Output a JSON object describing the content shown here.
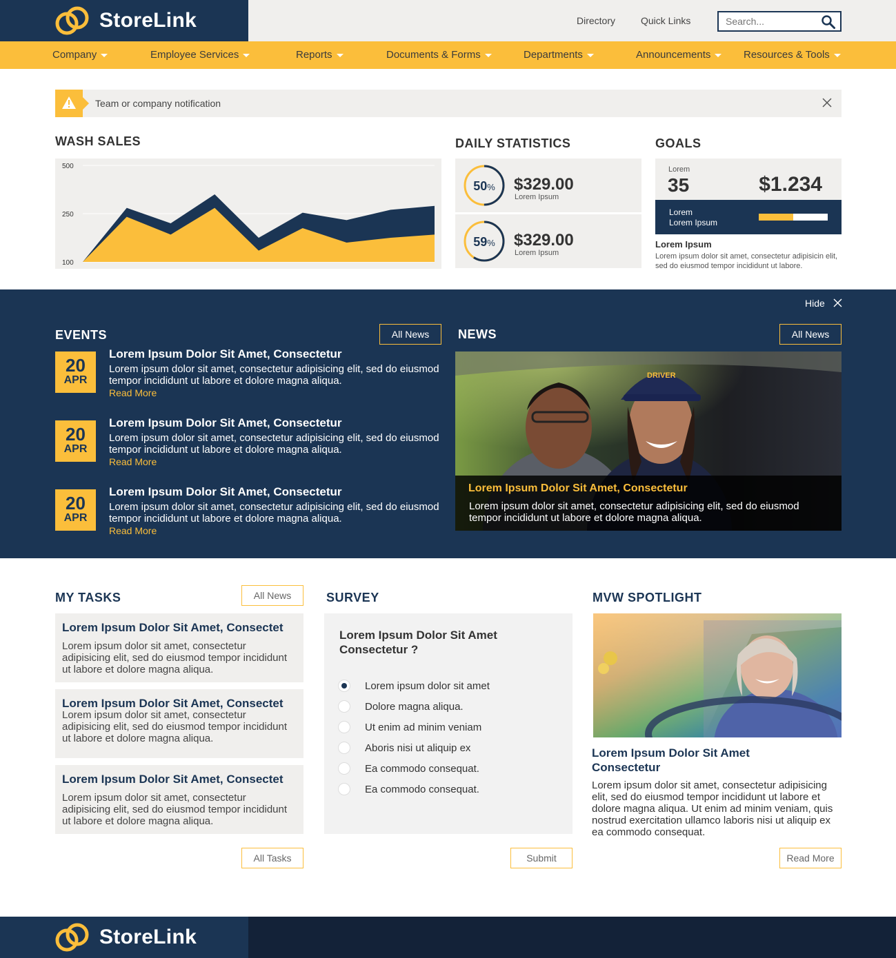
{
  "brand": {
    "name": "StoreLink",
    "accent": "#fbbe3b",
    "navy": "#1b3554"
  },
  "topbar": {
    "links": [
      "Directory",
      "Quick Links"
    ],
    "search_placeholder": "Search..."
  },
  "nav": {
    "items": [
      "Company",
      "Employee Services",
      "Reports",
      "Documents & Forms",
      "Departments",
      "Announcements",
      "Resources & Tools"
    ]
  },
  "notification": {
    "text": "Team or company notification"
  },
  "wash_sales": {
    "title": "WASH SALES"
  },
  "chart_data": {
    "type": "area",
    "title": "WASH SALES",
    "xlabel": "",
    "ylabel": "",
    "y_ticks": [
      "500",
      "250",
      "100"
    ],
    "x": [
      1,
      2,
      3,
      4,
      5,
      6,
      7,
      8,
      9
    ],
    "series": [
      {
        "color": "#1b3554",
        "values": [
          100,
          280,
          220,
          350,
          175,
          255,
          230,
          270,
          290
        ]
      },
      {
        "color": "#fbbe3b",
        "values": [
          100,
          240,
          185,
          280,
          135,
          205,
          160,
          175,
          185
        ]
      }
    ],
    "grid": true
  },
  "daily_stats": {
    "title": "DAILY STATISTICS",
    "items": [
      {
        "percent": 50,
        "percent_text": "50",
        "amount": "$329.00",
        "label": "Lorem Ipsum"
      },
      {
        "percent": 59,
        "percent_text": "59",
        "amount": "$329.00",
        "label": "Lorem Ipsum"
      }
    ],
    "percent_sign": "%"
  },
  "goals": {
    "title": "GOALS",
    "small_label": "Lorem",
    "count": "35",
    "amount": "$1.234",
    "bar_line1": "Lorem",
    "bar_line2": "Lorem Ipsum",
    "progress": 0.5,
    "heading": "Lorem Ipsum",
    "body": "Lorem ipsum dolor sit amet, consectetur adipisicin elit, sed do eiusmod tempor incididunt ut labore."
  },
  "band": {
    "hide_label": "Hide"
  },
  "events": {
    "title": "EVENTS",
    "button": "All News",
    "items": [
      {
        "day": "20",
        "month": "APR",
        "title": "Lorem Ipsum Dolor Sit Amet, Consectetur",
        "body": "Lorem ipsum dolor sit amet, consectetur adipisicing elit, sed do eiusmod tempor incididunt ut labore et dolore magna aliqua.",
        "more": "Read More"
      },
      {
        "day": "20",
        "month": "APR",
        "title": "Lorem Ipsum Dolor Sit Amet, Consectetur",
        "body": "Lorem ipsum dolor sit amet, consectetur adipisicing elit, sed do eiusmod tempor incididunt ut labore et dolore magna aliqua.",
        "more": "Read More"
      },
      {
        "day": "20",
        "month": "APR",
        "title": "Lorem Ipsum Dolor Sit Amet, Consectetur",
        "body": "Lorem ipsum dolor sit amet, consectetur adipisicing elit, sed do eiusmod tempor incididunt ut labore et dolore magna aliqua.",
        "more": "Read More"
      }
    ]
  },
  "news": {
    "title": "NEWS",
    "button": "All News",
    "cap_badge": "DRIVER",
    "headline": "Lorem Ipsum Dolor Sit Amet, Consectetur",
    "body": "Lorem ipsum dolor sit amet, consectetur adipisicing elit, sed do eiusmod tempor incididunt ut labore et dolore magna aliqua."
  },
  "tasks": {
    "title": "MY TASKS",
    "button": "All News",
    "footer_button": "All Tasks",
    "items": [
      {
        "title": "Lorem Ipsum Dolor Sit Amet, Consectet",
        "body": "Lorem ipsum dolor sit amet, consectetur adipisicing elit, sed do eiusmod tempor incididunt ut labore et dolore magna aliqua."
      },
      {
        "title": "Lorem Ipsum Dolor Sit Amet, Consectet",
        "body": "Lorem ipsum dolor sit amet, consectetur adipisicing elit, sed do eiusmod tempor incididunt ut labore et dolore magna aliqua."
      },
      {
        "title": "Lorem Ipsum Dolor Sit Amet, Consectet",
        "body": "Lorem ipsum dolor sit amet, consectetur adipisicing elit, sed do eiusmod tempor incididunt ut labore et dolore magna aliqua."
      }
    ]
  },
  "survey": {
    "title": "SURVEY",
    "question_line1": "Lorem Ipsum Dolor Sit Amet",
    "question_line2": "Consectetur ?",
    "options": [
      "Lorem ipsum dolor sit amet",
      "Dolore magna aliqua.",
      "Ut enim ad minim veniam",
      "Aboris nisi ut aliquip ex",
      "Ea commodo consequat.",
      "Ea commodo consequat."
    ],
    "selected_index": 0,
    "submit": "Submit"
  },
  "spotlight": {
    "title": "MVW SPOTLIGHT",
    "headline_line1": "Lorem Ipsum Dolor Sit Amet",
    "headline_line2": "Consectetur",
    "body": "Lorem ipsum dolor sit amet, consectetur adipisicing elit, sed do eiusmod tempor incididunt ut labore et dolore magna aliqua. Ut enim ad minim veniam, quis nostrud exercitation ullamco laboris nisi ut aliquip ex ea commodo consequat.",
    "button": "Read More"
  },
  "footer": {
    "brand": "StoreLink"
  }
}
